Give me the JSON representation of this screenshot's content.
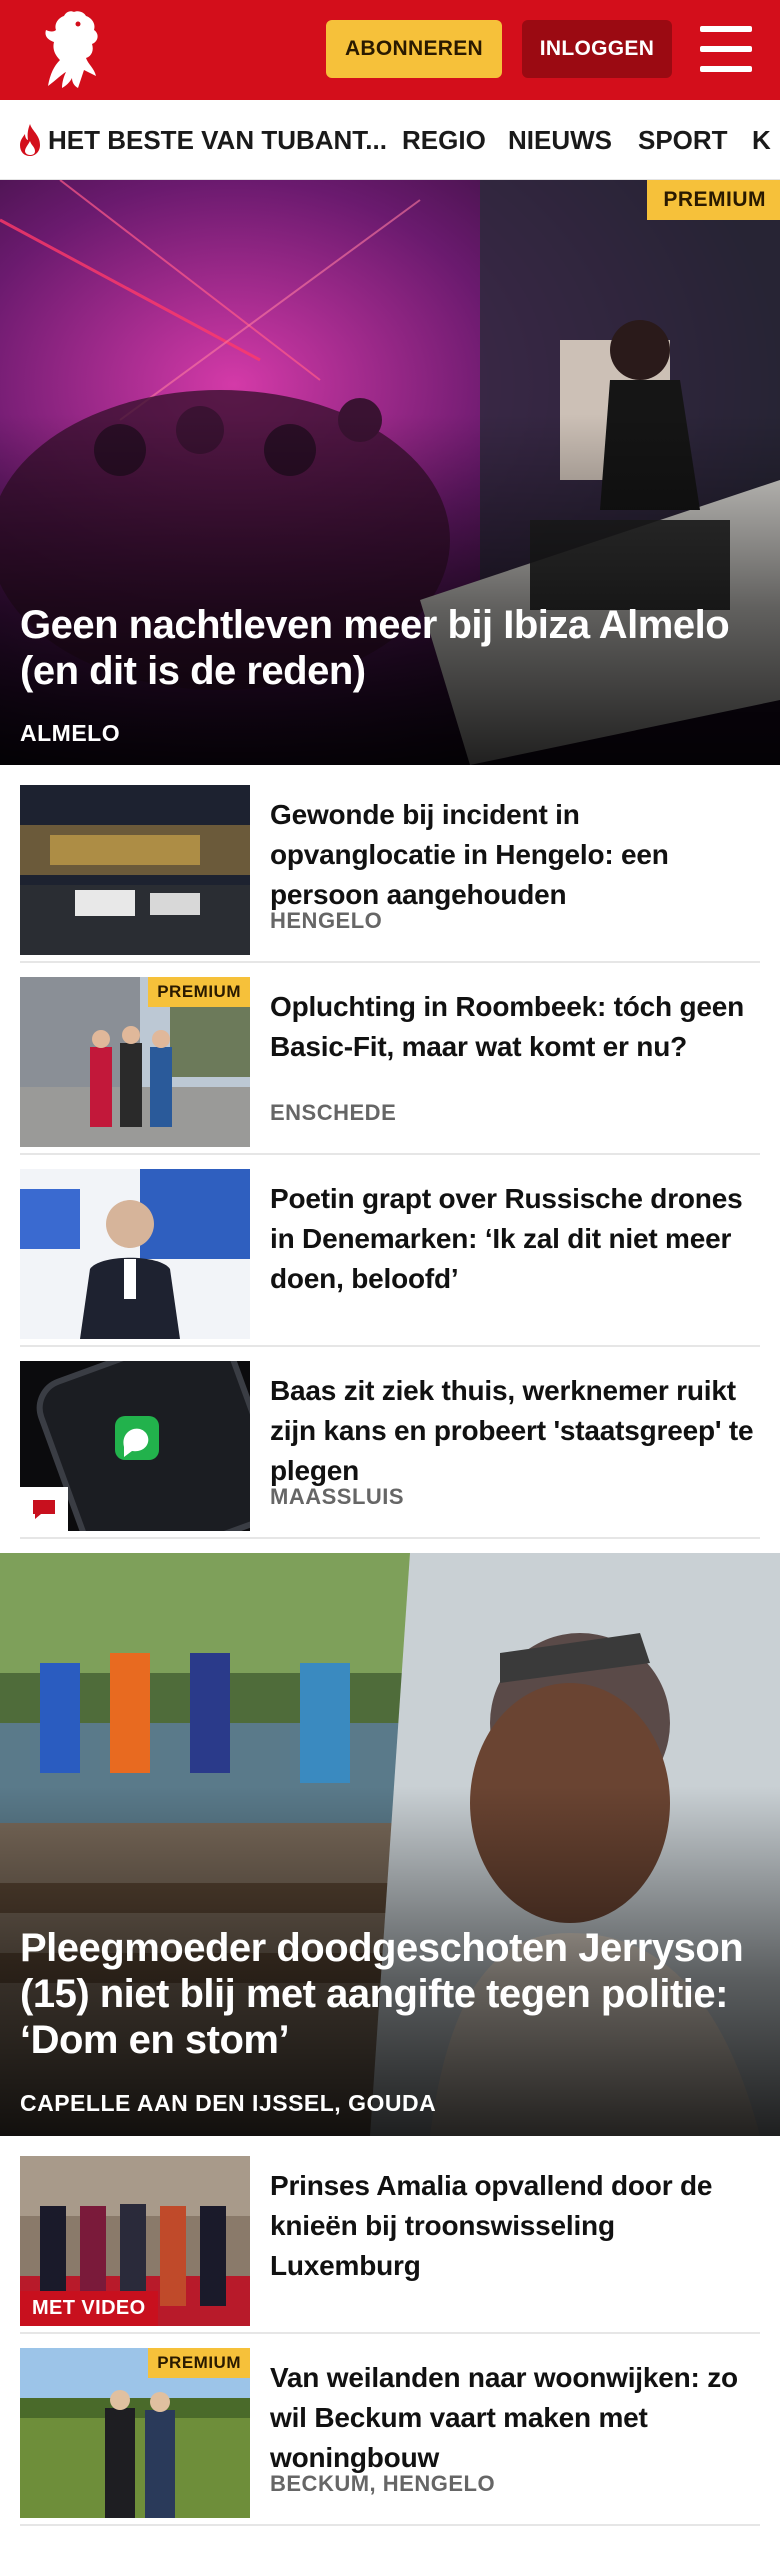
{
  "header": {
    "subscribe_label": "ABONNEREN",
    "login_label": "INLOGGEN",
    "brand_color": "#d30e1b",
    "subscribe_color": "#f6c13a"
  },
  "nav": {
    "items": [
      {
        "label": "HET BESTE VAN TUBANT...",
        "icon": "flame-icon"
      },
      {
        "label": "REGIO"
      },
      {
        "label": "NIEUWS"
      },
      {
        "label": "SPORT"
      },
      {
        "label": "K"
      }
    ]
  },
  "hero1": {
    "badge": "PREMIUM",
    "title": "Geen nachtleven meer bij Ibiza Almelo (en dit is de reden)",
    "location": "ALMELO"
  },
  "list1": [
    {
      "title": "Gewonde bij incident in opvanglocatie in Hengelo: een persoon aangehouden",
      "location": "HENGELO"
    },
    {
      "title": "Opluchting in Roombeek: tóch geen Basic-Fit, maar wat komt er nu?",
      "location": "ENSCHEDE",
      "badge": "PREMIUM"
    },
    {
      "title": "Poetin grapt over Russische drones in Denemarken: ‘Ik zal dit niet meer doen, beloofd’"
    },
    {
      "title": "Baas zit ziek thuis, werknemer ruikt zijn kans en probeert 'staatsgreep' te plegen",
      "location": "MAASSLUIS",
      "icon": "comment-icon"
    }
  ],
  "hero2": {
    "title": "Pleegmoeder doodgeschoten Jerryson (15) niet blij met aangifte tegen politie: ‘Dom en stom’",
    "location": "CAPELLE AAN DEN IJSSEL, GOUDA"
  },
  "list2": [
    {
      "title": "Prinses Amalia opvallend door de knieën bij troonswisseling Luxemburg",
      "badge": "MET VIDEO"
    },
    {
      "title": "Van weilanden naar woonwijken: zo wil Beckum vaart maken met woningbouw",
      "location": "BECKUM, HENGELO",
      "badge": "PREMIUM"
    }
  ]
}
